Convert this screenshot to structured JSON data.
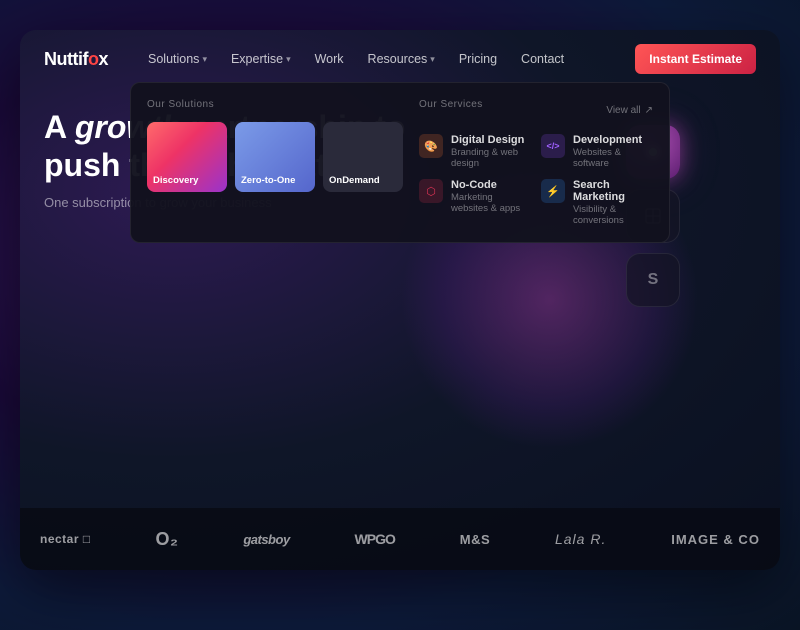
{
  "page": {
    "bg_colors": {
      "outer": "#1a0a3a",
      "inner": "#0f1628"
    }
  },
  "nav": {
    "logo_text": "Nuttif",
    "logo_suffix": "x",
    "links": [
      {
        "label": "Solutions",
        "has_dropdown": true
      },
      {
        "label": "Expertise",
        "has_dropdown": true
      },
      {
        "label": "Work",
        "has_dropdown": false
      },
      {
        "label": "Resources",
        "has_dropdown": true
      },
      {
        "label": "Pricing",
        "has_dropdown": false
      },
      {
        "label": "Contact",
        "has_dropdown": false
      }
    ],
    "cta_label": "Instant Estimate"
  },
  "dropdown": {
    "solutions_label": "Our Solutions",
    "services_label": "Our Services",
    "view_all_label": "View all",
    "solution_cards": [
      {
        "id": "discovery",
        "label": "Discovery",
        "style": "discovery"
      },
      {
        "id": "zero",
        "label": "Zero-to-One",
        "style": "zero"
      },
      {
        "id": "ondemand",
        "label": "OnDemand",
        "style": "ondemand"
      }
    ],
    "services": [
      {
        "id": "digital-design",
        "icon": "🎨",
        "icon_style": "orange",
        "name": "Digital Design",
        "desc": "Branding & web design"
      },
      {
        "id": "development",
        "icon": "</>",
        "icon_style": "purple",
        "name": "Development",
        "desc": "Websites & software"
      },
      {
        "id": "no-code",
        "icon": "⬡",
        "icon_style": "red",
        "name": "No-Code",
        "desc": "Marketing websites & apps"
      },
      {
        "id": "search-marketing",
        "icon": "⚡",
        "icon_style": "blue",
        "name": "Search Marketing",
        "desc": "Visibility & conversions"
      }
    ]
  },
  "hero": {
    "title_plain": "A ",
    "title_em": "growth",
    "title_rest": " partnership to push the right buttons",
    "subtitle": "One subscription to grow your business"
  },
  "app_icons": [
    {
      "id": "icon1",
      "style": "glowing",
      "symbol": ""
    },
    {
      "id": "icon2",
      "style": "dark1",
      "symbol": "◈"
    },
    {
      "id": "icon3",
      "style": "dark2",
      "symbol": "S"
    }
  ],
  "logo_bar": {
    "brands": [
      {
        "id": "nectar",
        "text": "nectar □",
        "css_class": "nectar"
      },
      {
        "id": "o2",
        "text": "O₂",
        "css_class": "o2"
      },
      {
        "id": "gatsby",
        "text": "gatsboy",
        "css_class": "gatsby"
      },
      {
        "id": "wpgo",
        "text": "WPGO",
        "css_class": "wpgo"
      },
      {
        "id": "ms",
        "text": "M&S",
        "css_class": "ms"
      },
      {
        "id": "lala",
        "text": "Lala R.",
        "css_class": "lala"
      },
      {
        "id": "imgco",
        "text": "IMAGE & CO",
        "css_class": "imgco"
      }
    ]
  }
}
